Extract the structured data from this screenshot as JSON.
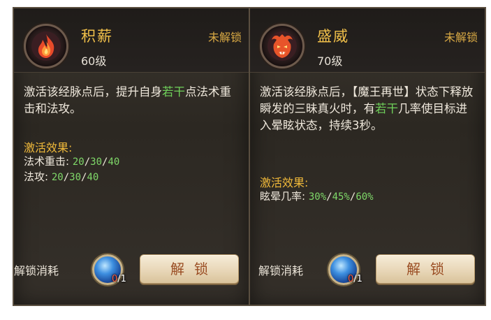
{
  "left": {
    "name": "积薪",
    "level": "60级",
    "status": "未解锁",
    "desc_parts": [
      "激活该经脉点后，提升自身",
      "若干",
      "点法术重击和法攻。"
    ],
    "effect_title": "激活效果:",
    "effects": [
      {
        "label": "法术重击:",
        "values": [
          "20",
          "30",
          "40"
        ]
      },
      {
        "label": "法攻:",
        "values": [
          "20",
          "30",
          "40"
        ]
      }
    ],
    "cost_label": "解锁消耗",
    "cost_have": "0",
    "cost_need": "/1",
    "button": "解锁",
    "emblem_icon": "flame-icon",
    "accent": "#f2c14a"
  },
  "right": {
    "name": "盛威",
    "level": "70级",
    "status": "未解锁",
    "desc_parts": [
      "激活该经脉点后，【魔王再世】状态下释放瞬发的三昧真火时，有",
      "若干",
      "几率使目标进入晕眩状态，持续3秒。"
    ],
    "effect_title": "激活效果:",
    "effects": [
      {
        "label": "眩晕几率:",
        "values": [
          "30%",
          "45%",
          "60%"
        ]
      }
    ],
    "cost_label": "解锁消耗",
    "cost_have": "0",
    "cost_need": "/1",
    "button": "解锁",
    "emblem_icon": "demon-face-icon",
    "accent": "#f2c14a"
  }
}
